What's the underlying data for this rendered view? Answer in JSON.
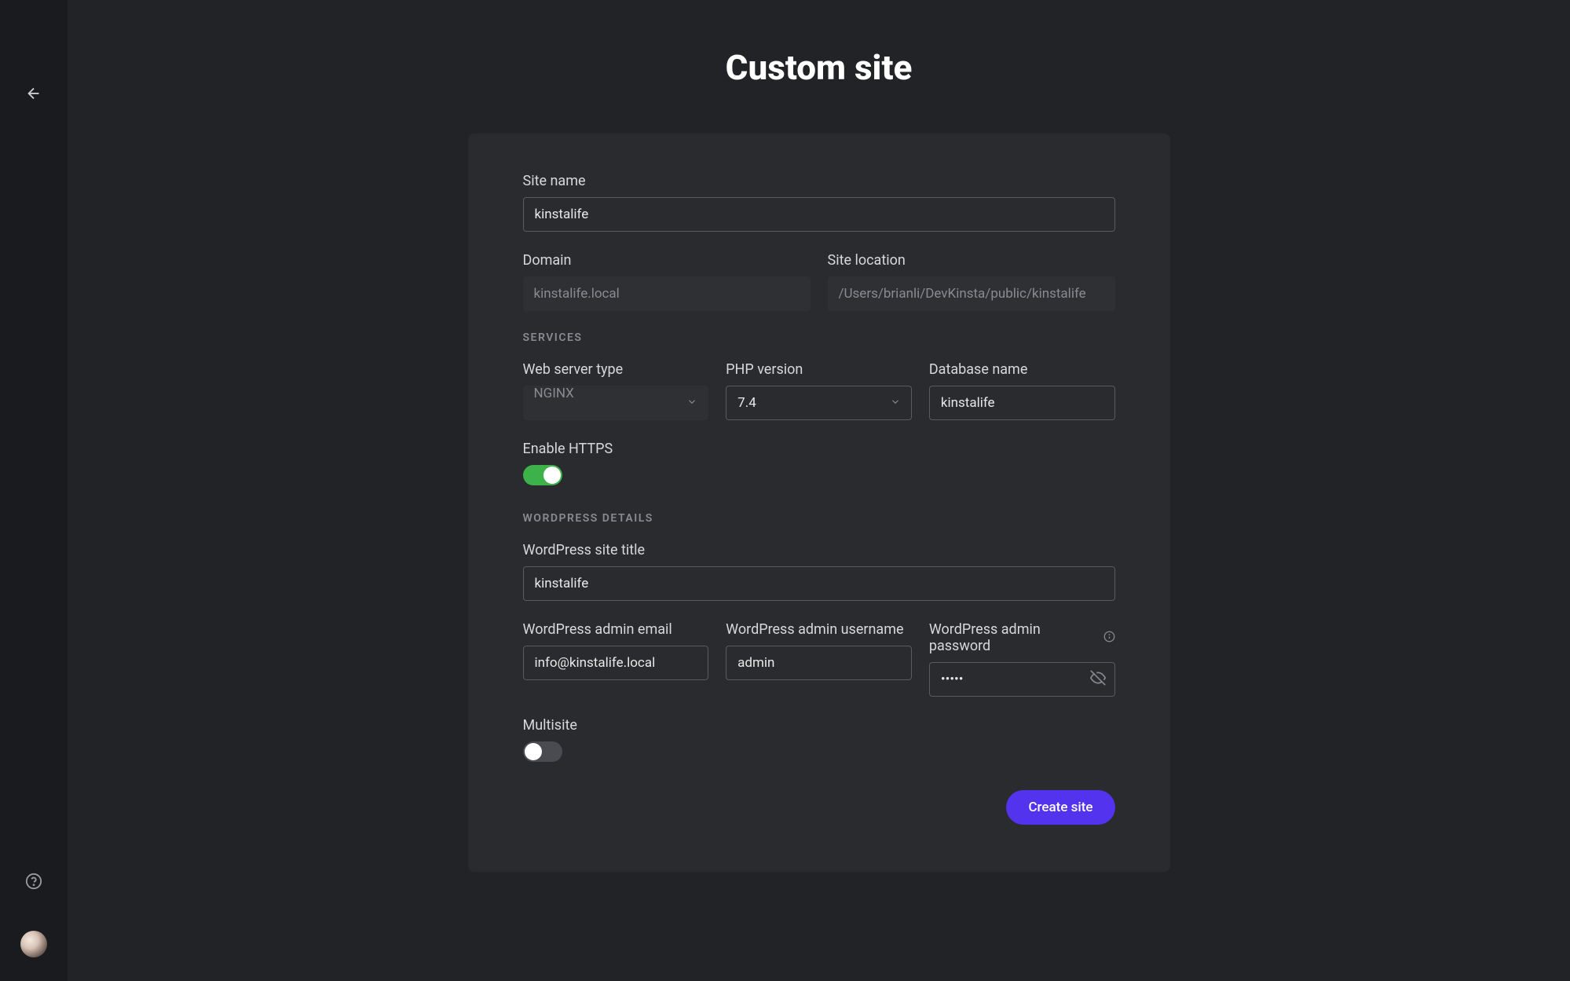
{
  "page": {
    "title": "Custom site"
  },
  "form": {
    "site_name": {
      "label": "Site name",
      "value": "kinstalife"
    },
    "domain": {
      "label": "Domain",
      "value": "kinstalife.local"
    },
    "site_location": {
      "label": "Site location",
      "value": "/Users/brianli/DevKinsta/public/kinstalife"
    }
  },
  "sections": {
    "services": "SERVICES",
    "wordpress": "WORDPRESS DETAILS"
  },
  "services": {
    "web_server": {
      "label": "Web server type",
      "value": "NGINX"
    },
    "php_version": {
      "label": "PHP version",
      "value": "7.4"
    },
    "database_name": {
      "label": "Database name",
      "value": "kinstalife"
    },
    "enable_https": {
      "label": "Enable HTTPS",
      "value": true
    }
  },
  "wordpress": {
    "site_title": {
      "label": "WordPress site title",
      "value": "kinstalife"
    },
    "admin_email": {
      "label": "WordPress admin email",
      "value": "info@kinstalife.local"
    },
    "admin_username": {
      "label": "WordPress admin username",
      "value": "admin"
    },
    "admin_password": {
      "label": "WordPress admin password",
      "value": "•••••"
    },
    "multisite": {
      "label": "Multisite",
      "value": false
    }
  },
  "actions": {
    "create_site": "Create site"
  }
}
